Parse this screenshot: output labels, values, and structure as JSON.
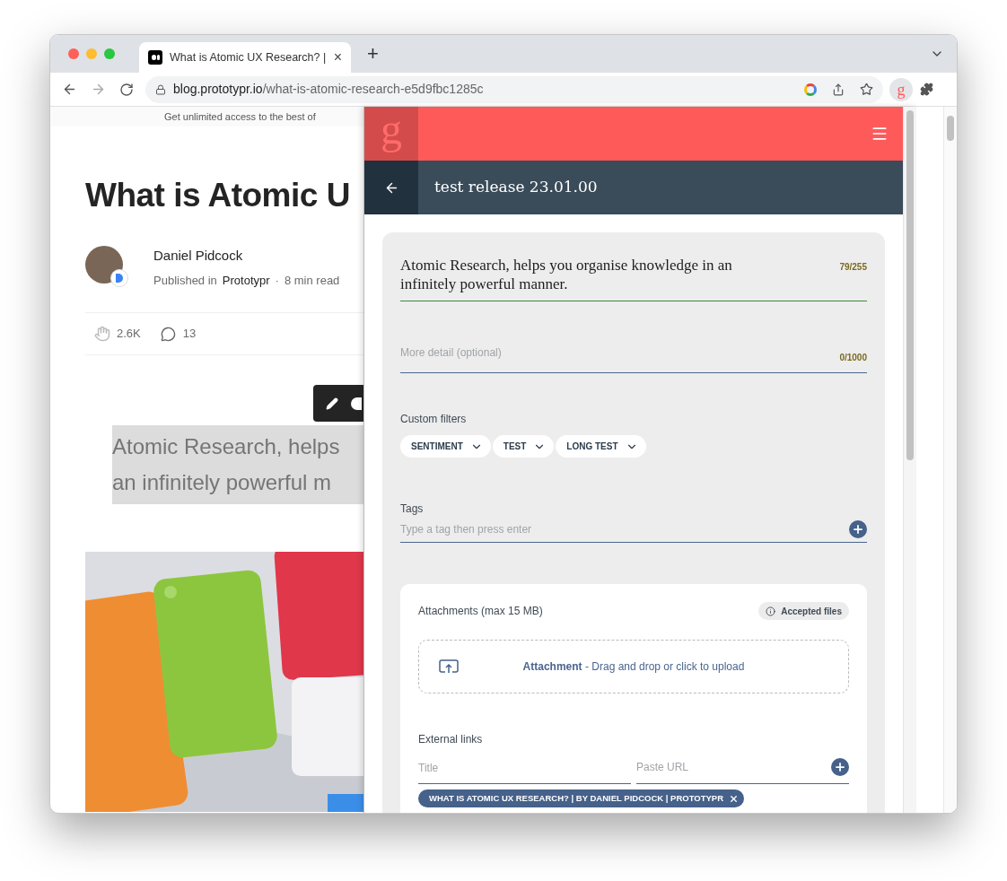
{
  "browser": {
    "tab_title": "What is Atomic UX Research? |",
    "tab_close": "×",
    "new_tab": "+",
    "url_host": "blog.prototypr.io",
    "url_path": "/what-is-atomic-research-e5d9fbc1285c",
    "extension_logo": "g"
  },
  "article": {
    "banner": "Get unlimited access to the best of",
    "title": "What is Atomic U",
    "author": "Daniel Pidcock",
    "published_prefix": "Published in",
    "publication": "Prototypr",
    "separator": "·",
    "read_time": "8 min read",
    "claps": "2.6K",
    "comments": "13",
    "highlight_lines": [
      "Atomic Research, helps",
      "an infinitely powerful m"
    ],
    "image": {
      "kind": "picture"
    }
  },
  "extension": {
    "logo": "g",
    "title": "test release 23.01.00",
    "statement": {
      "value": "Atomic Research, helps you organise knowledge in an infinitely powerful manner.",
      "counter": "79/255"
    },
    "detail": {
      "placeholder": "More detail (optional)",
      "counter": "0/1000"
    },
    "filters": {
      "label": "Custom filters",
      "items": [
        "SENTIMENT",
        "TEST",
        "LONG TEST"
      ]
    },
    "tags": {
      "label": "Tags",
      "placeholder": "Type a tag then press enter"
    },
    "attachments": {
      "label": "Attachments (max 15 MB)",
      "accepted": "Accepted files",
      "drop_text": "**Attachment** - Drag and drop or click to upload"
    },
    "links": {
      "label": "External links",
      "title_placeholder": "Title",
      "url_placeholder": "Paste URL",
      "chips": [
        "WHAT IS ATOMIC UX RESEARCH? | BY DANIEL PIDCOCK | PROTOTYPR"
      ]
    }
  }
}
